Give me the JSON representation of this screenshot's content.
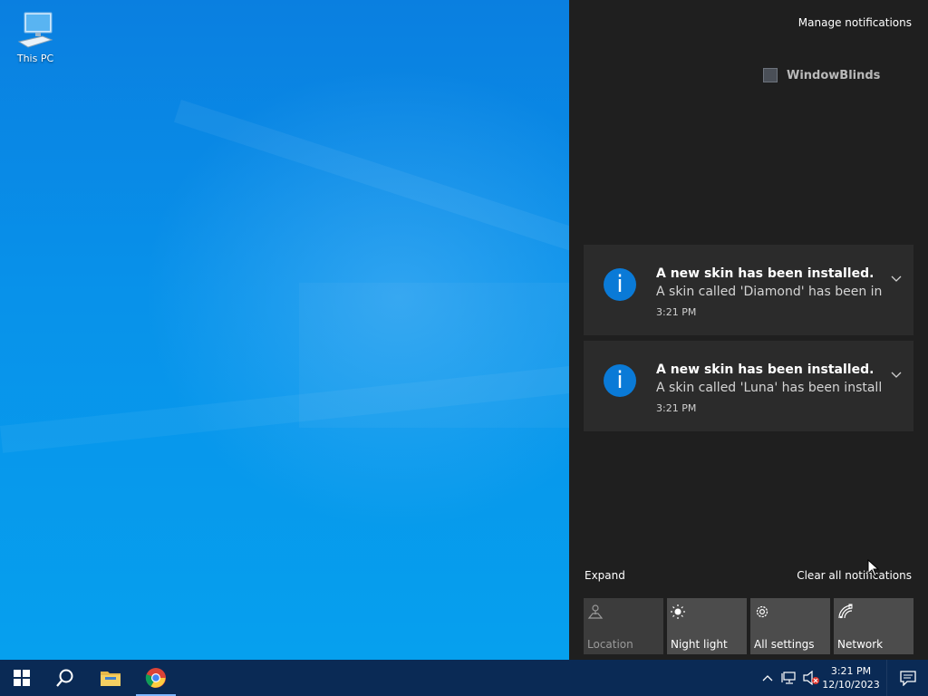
{
  "desktop": {
    "icons": [
      {
        "label": "This PC",
        "icon": "this-pc-icon"
      }
    ]
  },
  "action_center": {
    "manage_label": "Manage notifications",
    "group_app": "WindowBlinds",
    "notifications": [
      {
        "title": "A new skin has been installed.",
        "body": "A skin called 'Diamond' has been inst",
        "time": "3:21 PM",
        "icon": "info-icon"
      },
      {
        "title": "A new skin has been installed.",
        "body": "A skin called 'Luna' has been installed",
        "time": "3:21 PM",
        "icon": "info-icon"
      }
    ],
    "expand_label": "Expand",
    "clear_all_label": "Clear all notifications",
    "quick_actions": [
      {
        "label": "Location",
        "icon": "location-icon",
        "enabled": false
      },
      {
        "label": "Night light",
        "icon": "night-light-icon",
        "enabled": true
      },
      {
        "label": "All settings",
        "icon": "gear-icon",
        "enabled": true
      },
      {
        "label": "Network",
        "icon": "network-icon",
        "enabled": true
      }
    ]
  },
  "taskbar": {
    "apps": [
      {
        "name": "start",
        "icon": "windows-logo-icon"
      },
      {
        "name": "search",
        "icon": "search-icon"
      },
      {
        "name": "file-explorer",
        "icon": "folder-icon"
      },
      {
        "name": "chrome",
        "icon": "chrome-icon",
        "active": true
      }
    ],
    "clock": {
      "time": "3:21 PM",
      "date": "12/10/2023"
    }
  },
  "colors": {
    "desktop_blue": "#0a8ae6",
    "action_center_bg": "#1f1f1f",
    "notification_bg": "#2b2b2b",
    "accent": "#0a7ad7",
    "taskbar_bg": "#0a2a55"
  }
}
